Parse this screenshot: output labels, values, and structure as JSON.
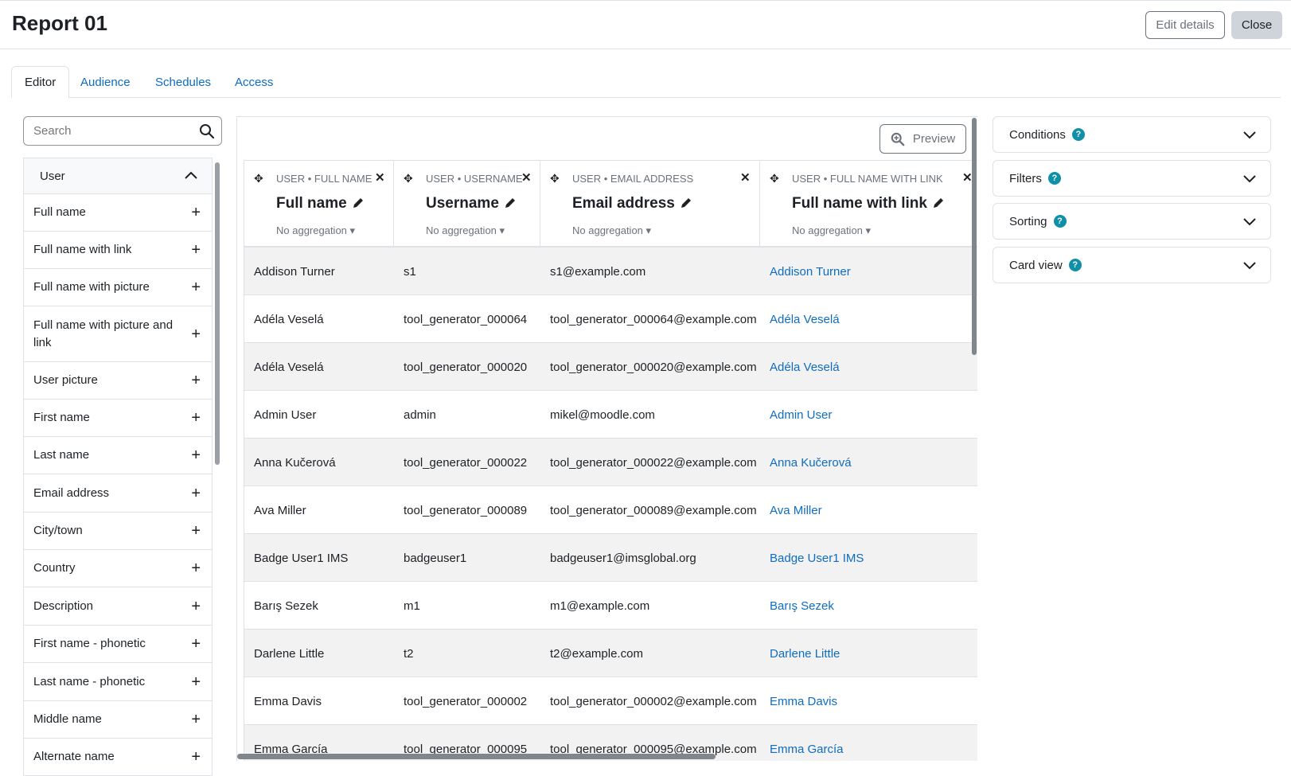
{
  "header": {
    "title": "Report 01",
    "edit_label": "Edit details",
    "close_label": "Close"
  },
  "tabs": [
    "Editor",
    "Audience",
    "Schedules",
    "Access"
  ],
  "sidebar": {
    "search_placeholder": "Search",
    "group": "User",
    "items": [
      "Full name",
      "Full name with link",
      "Full name with picture",
      "Full name with picture and link",
      "User picture",
      "First name",
      "Last name",
      "Email address",
      "City/town",
      "Country",
      "Description",
      "First name - phonetic",
      "Last name - phonetic",
      "Middle name",
      "Alternate name"
    ]
  },
  "preview_label": "Preview",
  "columns": [
    {
      "category": "USER • FULL NAME",
      "title": "Full name",
      "aggregation": "No aggregation"
    },
    {
      "category": "USER • USERNAME",
      "title": "Username",
      "aggregation": "No aggregation"
    },
    {
      "category": "USER • EMAIL ADDRESS",
      "title": "Email address",
      "aggregation": "No aggregation"
    },
    {
      "category": "USER • FULL NAME WITH LINK",
      "title": "Full name with link",
      "aggregation": "No aggregation"
    }
  ],
  "rows": [
    [
      "Addison Turner",
      "s1",
      "s1@example.com",
      "Addison Turner"
    ],
    [
      "Adéla Veselá",
      "tool_generator_000064",
      "tool_generator_000064@example.com",
      "Adéla Veselá"
    ],
    [
      "Adéla Veselá",
      "tool_generator_000020",
      "tool_generator_000020@example.com",
      "Adéla Veselá"
    ],
    [
      "Admin User",
      "admin",
      "mikel@moodle.com",
      "Admin User"
    ],
    [
      "Anna Kučerová",
      "tool_generator_000022",
      "tool_generator_000022@example.com",
      "Anna Kučerová"
    ],
    [
      "Ava Miller",
      "tool_generator_000089",
      "tool_generator_000089@example.com",
      "Ava Miller"
    ],
    [
      "Badge User1 IMS",
      "badgeuser1",
      "badgeuser1@imsglobal.org",
      "Badge User1 IMS"
    ],
    [
      "Barış Sezek",
      "m1",
      "m1@example.com",
      "Barış Sezek"
    ],
    [
      "Darlene Little",
      "t2",
      "t2@example.com",
      "Darlene Little"
    ],
    [
      "Emma Davis",
      "tool_generator_000002",
      "tool_generator_000002@example.com",
      "Emma Davis"
    ],
    [
      "Emma García",
      "tool_generator_000095",
      "tool_generator_000095@example.com",
      "Emma García"
    ]
  ],
  "panels": [
    "Conditions",
    "Filters",
    "Sorting",
    "Card view"
  ],
  "colors": {
    "link": "#0f6cbf",
    "help": "#0f8fa8"
  }
}
